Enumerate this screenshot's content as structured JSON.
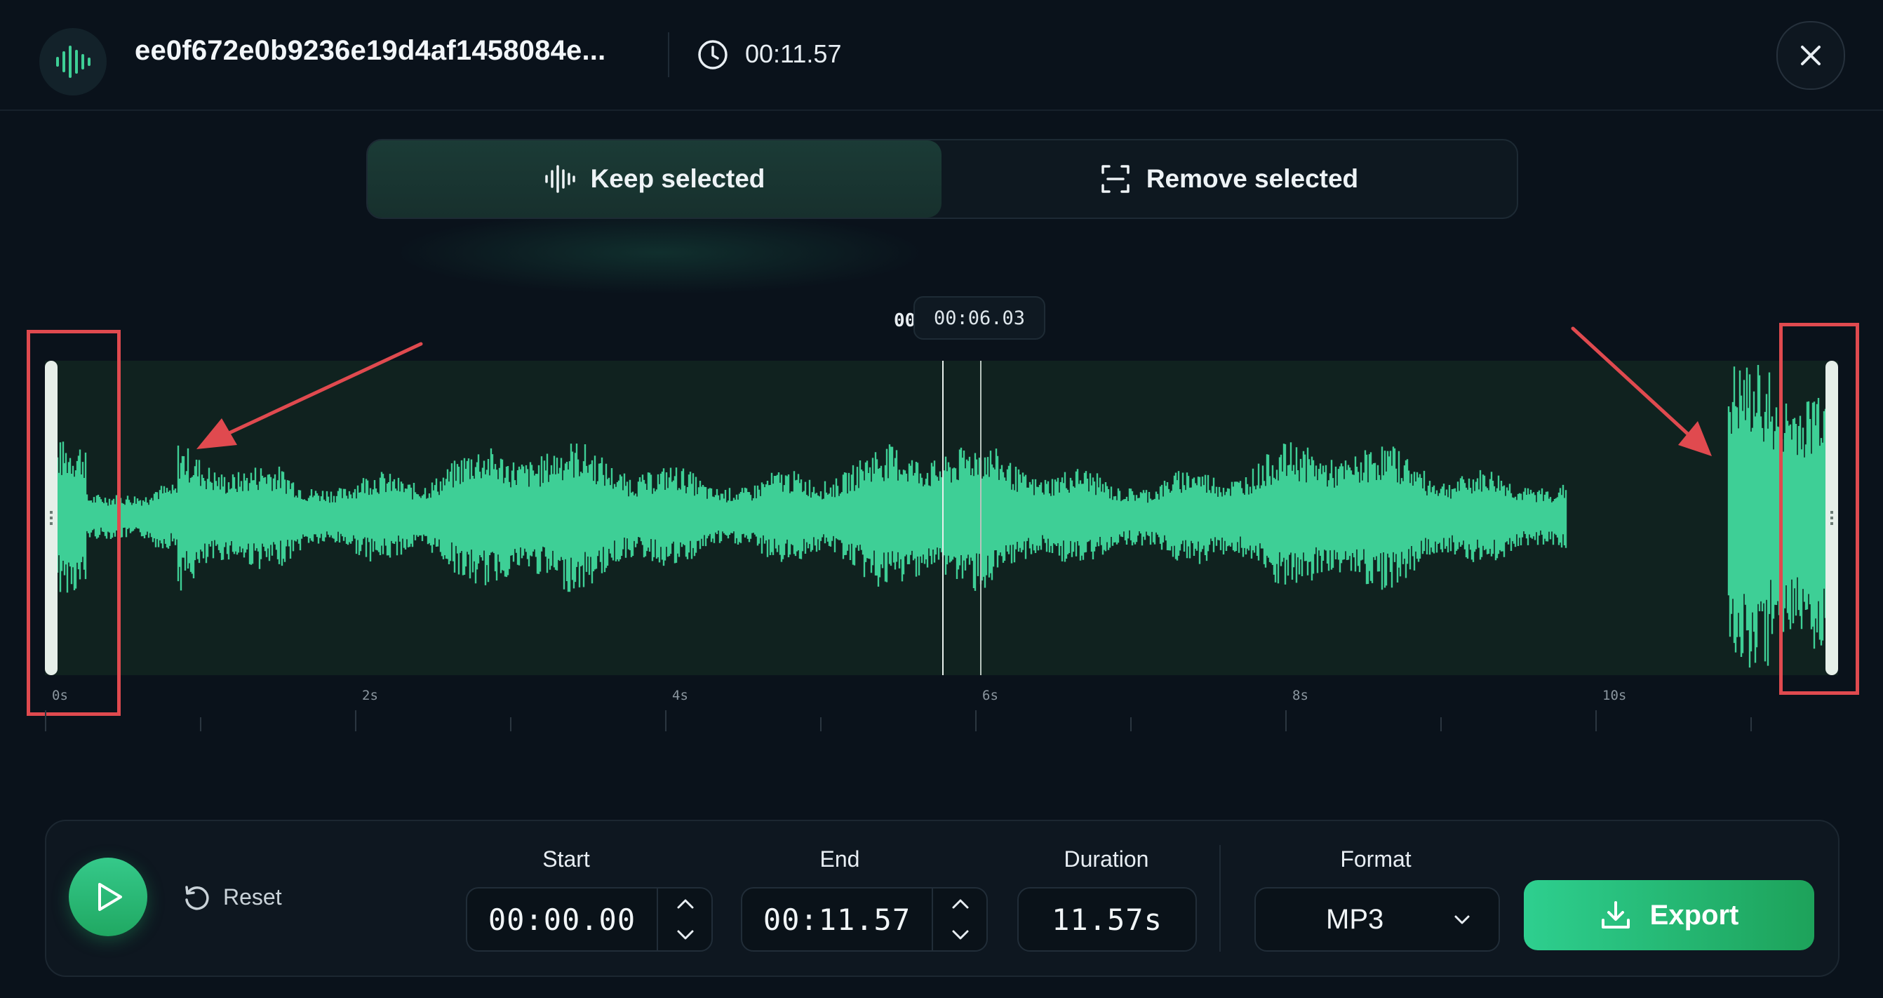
{
  "header": {
    "file_name": "ee0f672e0b9236e19d4af1458084e...",
    "duration": "00:11.57",
    "app_icon": "waveform-icon",
    "clock_icon": "clock-icon",
    "close_icon": "close-icon"
  },
  "mode": {
    "keep_label": "Keep selected",
    "remove_label": "Remove selected",
    "active": "keep"
  },
  "waveform": {
    "tooltip_time": "00:06.03",
    "tooltip_ghost": "00",
    "timeline_labels": [
      "0s",
      "2s",
      "4s",
      "6s",
      "8s",
      "10s"
    ],
    "wave_color": "#3ecf96",
    "selection_start_s": 0.0,
    "selection_end_s": 11.57,
    "annotation_color": "#e04a4f"
  },
  "controls": {
    "reset_label": "Reset",
    "start_label": "Start",
    "start_value": "00:00.00",
    "end_label": "End",
    "end_value": "00:11.57",
    "duration_label": "Duration",
    "duration_value": "11.57s",
    "format_label": "Format",
    "format_value": "MP3",
    "export_label": "Export"
  },
  "colors": {
    "accent": "#2ecf8f",
    "background": "#0a121b"
  }
}
